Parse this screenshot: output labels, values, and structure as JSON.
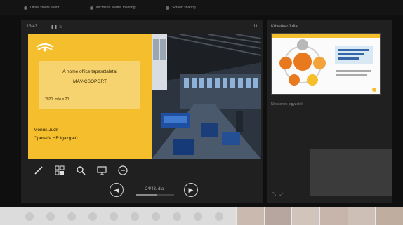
{
  "browser": {
    "tabs": [
      {
        "label": "Office Hours event"
      },
      {
        "label": "Microsoft Teams meeting"
      },
      {
        "label": "Screen sharing"
      }
    ]
  },
  "presenter": {
    "slide_counter": "13/43",
    "timer": "1:11",
    "slide": {
      "title": "A home office tapasztalatai",
      "org": "MÁV-CSOPORT",
      "date": "2020. május 20.",
      "author": "Mónus Judit",
      "role": "Operatív HR igazgató"
    },
    "nav": {
      "label": "24/43. dia",
      "progress": 0.56
    },
    "tools": [
      {
        "icon": "pen-icon"
      },
      {
        "icon": "slides-grid-icon"
      },
      {
        "icon": "zoom-icon"
      },
      {
        "icon": "screen-icon"
      },
      {
        "icon": "more-icon"
      }
    ]
  },
  "side": {
    "next_label": "Következő dia",
    "notes_label": "Nincsenek jegyzetek"
  },
  "colors": {
    "slide_yellow": "#f4be2c",
    "slide_box": "#f7d370",
    "accent_orange": "#e9791f"
  }
}
